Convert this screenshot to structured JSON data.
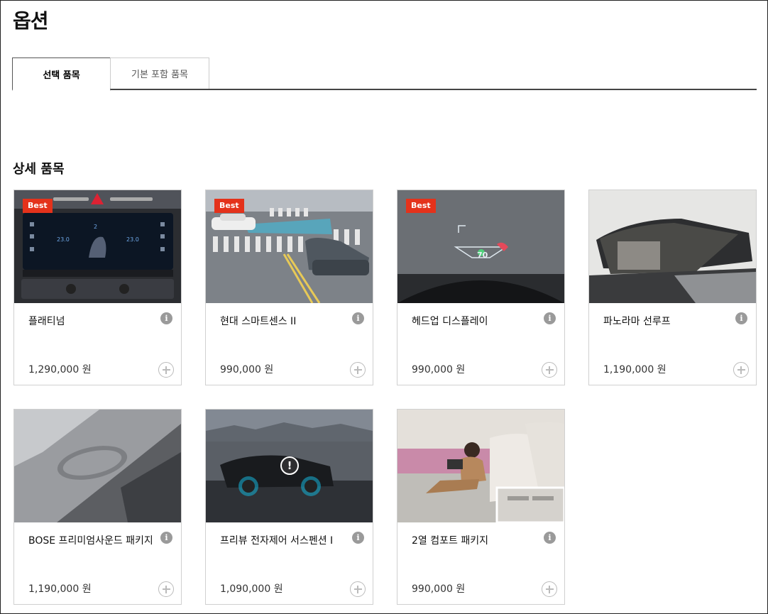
{
  "page": {
    "title": "옵션"
  },
  "tabs": [
    {
      "label": "선택 품목",
      "active": true
    },
    {
      "label": "기본 포함 품목",
      "active": false
    }
  ],
  "section": {
    "title": "상세 품목"
  },
  "colors": {
    "badge": "#e4321b",
    "tab_border": "#444444"
  },
  "cards": [
    {
      "name": "플래티넘",
      "price": "1,290,000 원",
      "badge": "Best"
    },
    {
      "name": "현대 스마트센스 II",
      "price": "990,000 원",
      "badge": "Best"
    },
    {
      "name": "헤드업 디스플레이",
      "price": "990,000 원",
      "badge": "Best"
    },
    {
      "name": "파노라마 선루프",
      "price": "1,190,000 원",
      "badge": ""
    },
    {
      "name": "BOSE 프리미엄사운드 패키지",
      "price": "1,190,000 원",
      "badge": ""
    },
    {
      "name": "프리뷰 전자제어 서스펜션 I",
      "price": "1,090,000 원",
      "badge": ""
    },
    {
      "name": "2열 컴포트 패키지",
      "price": "990,000 원",
      "badge": ""
    }
  ],
  "icons": {
    "info": "info-icon",
    "add": "plus-circle-icon",
    "warning": "exclamation-icon"
  },
  "hud": {
    "speed": "70"
  },
  "climate": {
    "temp_left": "23.0",
    "temp_right": "23.0",
    "fan": "2"
  }
}
